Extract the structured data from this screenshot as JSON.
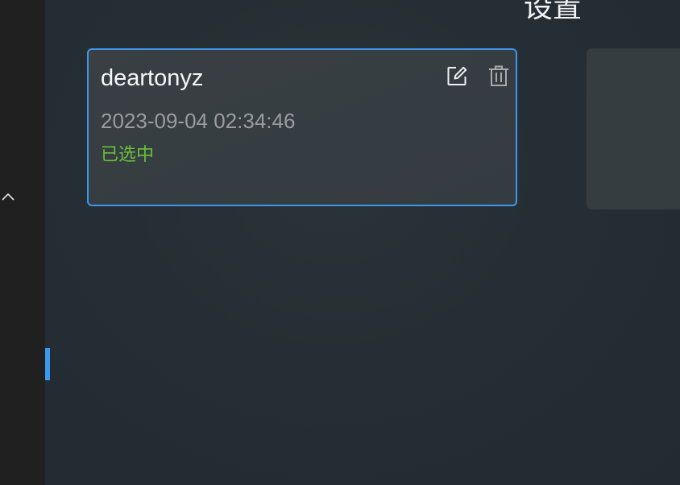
{
  "page": {
    "title": "设置"
  },
  "sidebar": {
    "collapse_icon": "chevron-up-icon"
  },
  "cards": [
    {
      "name": "deartonyz",
      "time": "2023-09-04 02:34:46",
      "status": "已选中",
      "edit_icon": "edit-icon",
      "delete_icon": "trash-icon"
    }
  ],
  "colors": {
    "accent": "#3f97ec",
    "status_selected": "#67c23a",
    "card_bg": "#393f43",
    "rail_bg": "#202020",
    "page_bg": "#222b31"
  }
}
